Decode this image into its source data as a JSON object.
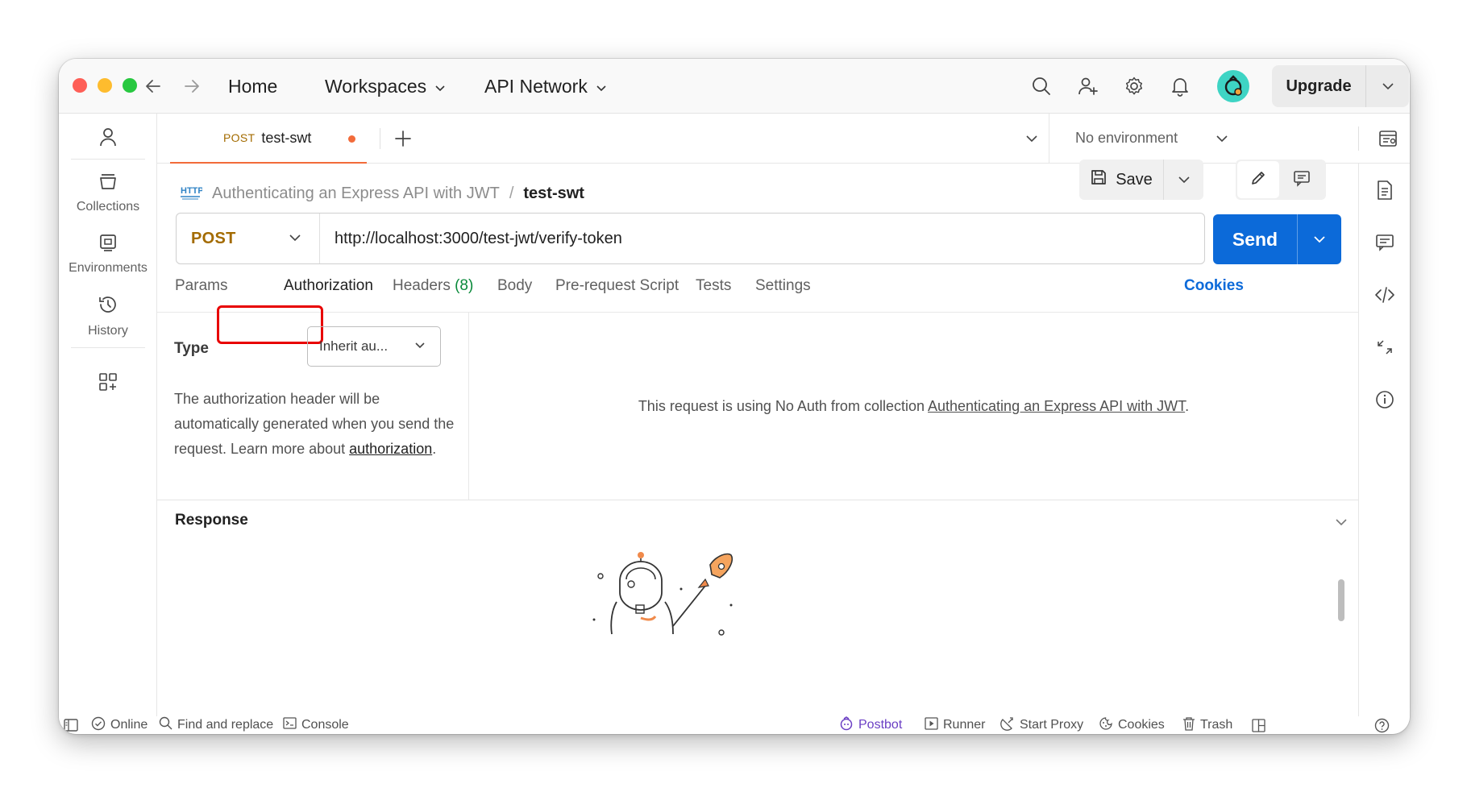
{
  "titlebar": {
    "nav_home": "Home",
    "nav_workspaces": "Workspaces",
    "nav_api_network": "API Network",
    "upgrade_label": "Upgrade"
  },
  "sidebar": {
    "items": [
      {
        "label": "",
        "icon": "user-icon"
      },
      {
        "label": "Collections",
        "icon": "collections-icon"
      },
      {
        "label": "Environments",
        "icon": "environments-icon"
      },
      {
        "label": "History",
        "icon": "history-icon"
      },
      {
        "label": "",
        "icon": "apps-grid-icon"
      }
    ]
  },
  "tabs": {
    "active": {
      "method": "POST",
      "name": "test-swt",
      "unsaved": true
    },
    "environment": "No environment"
  },
  "breadcrumb": {
    "collection": "Authenticating an Express API with JWT",
    "separator": "/",
    "request": "test-swt"
  },
  "toolbar": {
    "save_label": "Save"
  },
  "request": {
    "method": "POST",
    "url": "http://localhost:3000/test-jwt/verify-token",
    "send_label": "Send"
  },
  "subtabs": {
    "params": "Params",
    "authorization": "Authorization",
    "headers": "Headers",
    "headers_count": "(8)",
    "body": "Body",
    "prerequest": "Pre-request Script",
    "tests": "Tests",
    "settings": "Settings",
    "cookies": "Cookies",
    "active": "Authorization"
  },
  "auth": {
    "type_label": "Type",
    "type_value": "Inherit au...",
    "description": "The authorization header will be automatically generated when you send the request. Learn more about ",
    "description_link": "authorization",
    "description_end": ".",
    "notice_prefix": "This request is using No Auth from collection ",
    "notice_link": "Authenticating an Express API with JWT",
    "notice_suffix": "."
  },
  "response": {
    "title": "Response"
  },
  "statusbar": {
    "online": "Online",
    "find_replace": "Find and replace",
    "console": "Console",
    "postbot": "Postbot",
    "runner": "Runner",
    "start_proxy": "Start Proxy",
    "cookies": "Cookies",
    "trash": "Trash"
  },
  "colors": {
    "accent_blue": "#0c6ad9",
    "method_post": "#a36b00",
    "tab_indicator": "#f26b3a",
    "highlight_red": "#e80000",
    "headers_count_green": "#0a8a3b",
    "postbot_purple": "#6b3fc4"
  }
}
